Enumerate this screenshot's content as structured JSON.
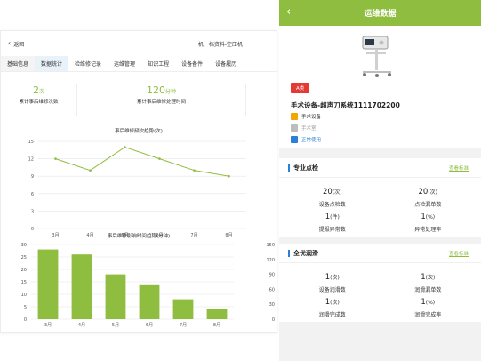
{
  "left": {
    "back_label": "返回",
    "breadcrumb": "一机一档资料-空压机",
    "tabs": [
      "基础信息",
      "数据统计",
      "检维修记录",
      "运维管理",
      "知识工程",
      "设备备件",
      "设备履历"
    ],
    "active_tab": "数据统计",
    "stats": [
      {
        "value": "2",
        "unit": "次",
        "label": "累计事后维修次数"
      },
      {
        "value": "120",
        "unit": "分钟",
        "label": "累计事后维修处理时间"
      }
    ]
  },
  "chart_data": [
    {
      "type": "line",
      "title": "事后维修频次趋势(次)",
      "categories": [
        "3月",
        "4月",
        "5月",
        "6月",
        "7月",
        "8月"
      ],
      "values": [
        12,
        10,
        14,
        12,
        10,
        9
      ],
      "ylim": [
        0,
        15
      ],
      "yticks": [
        0,
        3,
        6,
        9,
        12,
        15
      ],
      "color": "#8fbd3f",
      "grid": true
    },
    {
      "type": "bar",
      "title": "事后维修影响时间趋势(分钟)",
      "categories": [
        "3月",
        "4月",
        "5月",
        "6月",
        "7月",
        "8月"
      ],
      "values": [
        28,
        26,
        18,
        14,
        8,
        4
      ],
      "ylim": [
        0,
        30
      ],
      "yticks": [
        0,
        5,
        10,
        15,
        20,
        25,
        30
      ],
      "y2ticks": [
        0,
        30,
        60,
        90,
        120,
        150
      ],
      "color": "#8fbd3f",
      "grid": true
    }
  ],
  "mobile": {
    "title": "运维数据",
    "grade": "A类",
    "device_name": "手术设备-超声刀系统1111702200",
    "category": "手术设备",
    "location": "手术室",
    "status": "正常使用",
    "colors": {
      "accent": "#8fbd3f",
      "grade": "#e53935",
      "category_icon": "#f0a800",
      "location_icon": "#bdbdbd",
      "status_icon": "#2b7fd4"
    },
    "sections": [
      {
        "title": "专业点检",
        "link": "查看标准",
        "items": [
          {
            "value": "20",
            "unit": "(次)",
            "label": "设备点检数"
          },
          {
            "value": "20",
            "unit": "(次)",
            "label": "点检漏单数"
          },
          {
            "value": "1",
            "unit": "(件)",
            "label": "提报异常数"
          },
          {
            "value": "1",
            "unit": "(%)",
            "label": "异常处理率"
          }
        ]
      },
      {
        "title": "全优润滑",
        "link": "查看标准",
        "items": [
          {
            "value": "1",
            "unit": "(次)",
            "label": "设备润滑数"
          },
          {
            "value": "1",
            "unit": "(次)",
            "label": "润滑漏单数"
          },
          {
            "value": "1",
            "unit": "(次)",
            "label": "润滑完成数"
          },
          {
            "value": "1",
            "unit": "(%)",
            "label": "润滑完成率"
          }
        ]
      }
    ]
  }
}
